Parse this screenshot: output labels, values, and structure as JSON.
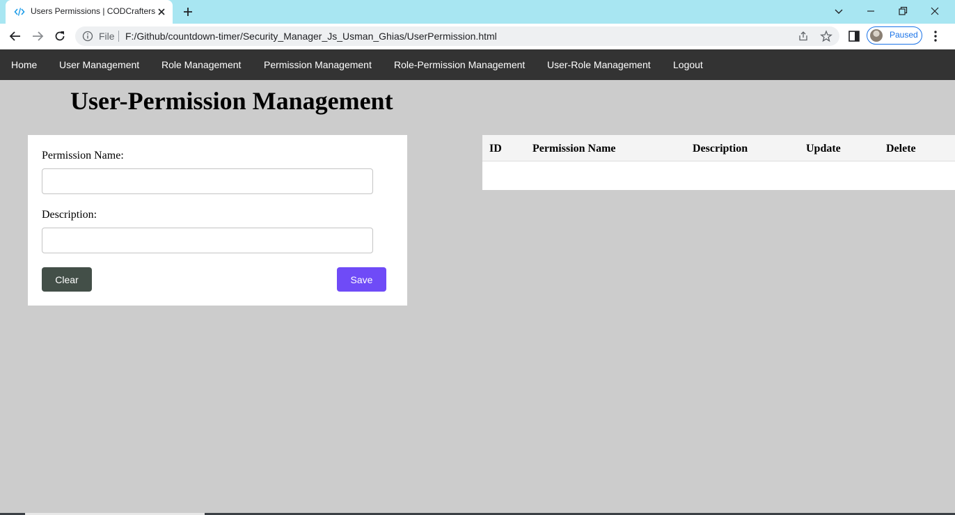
{
  "browser": {
    "tab_title": "Users Permissions | CODCrafters",
    "omnibox_scheme_label": "File",
    "url": "F:/Github/countdown-timer/Security_Manager_Js_Usman_Ghias/UserPermission.html",
    "profile_status": "Paused",
    "accent_color": "#1a73e8",
    "tab_strip_color": "#a8e6f2"
  },
  "nav": {
    "items": [
      {
        "label": "Home"
      },
      {
        "label": "User Management"
      },
      {
        "label": "Role Management"
      },
      {
        "label": "Permission Management"
      },
      {
        "label": "Role-Permission Management"
      },
      {
        "label": "User-Role Management"
      },
      {
        "label": "Logout"
      }
    ]
  },
  "page": {
    "title": "User-Permission Management"
  },
  "form": {
    "permission_name_label": "Permission Name:",
    "permission_name_value": "",
    "description_label": "Description:",
    "description_value": "",
    "clear_label": "Clear",
    "save_label": "Save",
    "clear_color": "#434f48",
    "save_color": "#6f4bf7"
  },
  "table": {
    "columns": [
      "ID",
      "Permission Name",
      "Description",
      "Update",
      "Delete"
    ],
    "rows": []
  }
}
